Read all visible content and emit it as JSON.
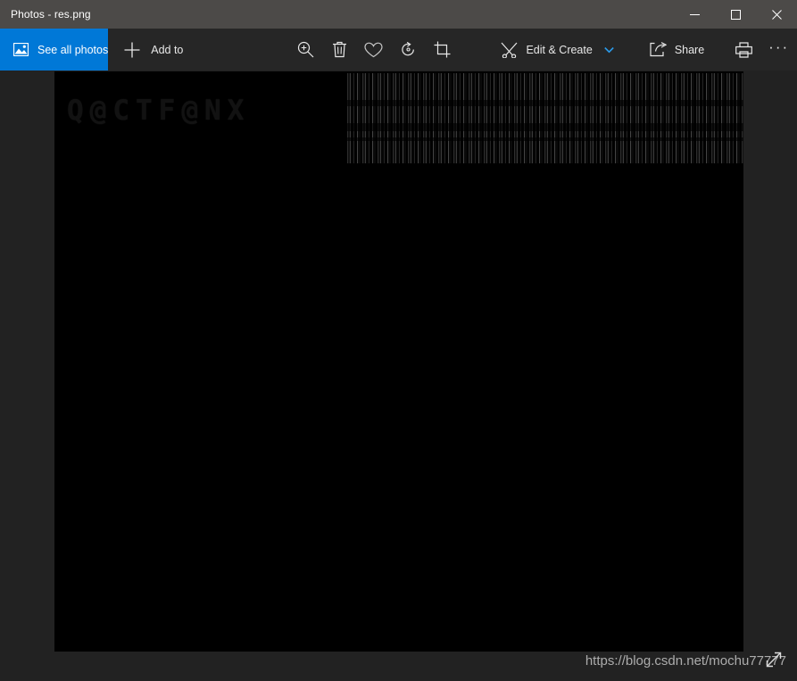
{
  "window": {
    "title": "Photos - res.png",
    "controls": [
      {
        "name": "minimize",
        "glyph": "minimize-icon"
      },
      {
        "name": "maximize",
        "glyph": "maximize-icon"
      },
      {
        "name": "close",
        "glyph": "close-icon"
      }
    ]
  },
  "toolbar": {
    "see_all_photos_label": "See all photos",
    "see_all_photos_icon": "picture-icon",
    "add_to_label": "Add to",
    "add_to_icon": "plus-icon",
    "zoom_icon": "zoom-in-icon",
    "delete_icon": "trash-icon",
    "favorite_icon": "heart-icon",
    "rotate_icon": "rotate-icon",
    "crop_icon": "crop-icon",
    "edit_create_label": "Edit & Create",
    "edit_create_icon": "edit-create-icon",
    "edit_create_chevron": "chevron-down-icon",
    "share_label": "Share",
    "share_icon": "share-icon",
    "print_icon": "print-icon",
    "more_label": "···",
    "accent_color": "#0078d7",
    "chrome_color": "#262626",
    "titlebar_color": "#4c4a48"
  },
  "viewer": {
    "image_name": "res.png",
    "image_background": "#000000",
    "embedded_text": "Q@CTF@NX",
    "noise_region_label": "barcode-noise-pattern",
    "expand_icon": "expand-fullscreen-icon"
  },
  "watermark": {
    "text": "https://blog.csdn.net/mochu77777"
  }
}
